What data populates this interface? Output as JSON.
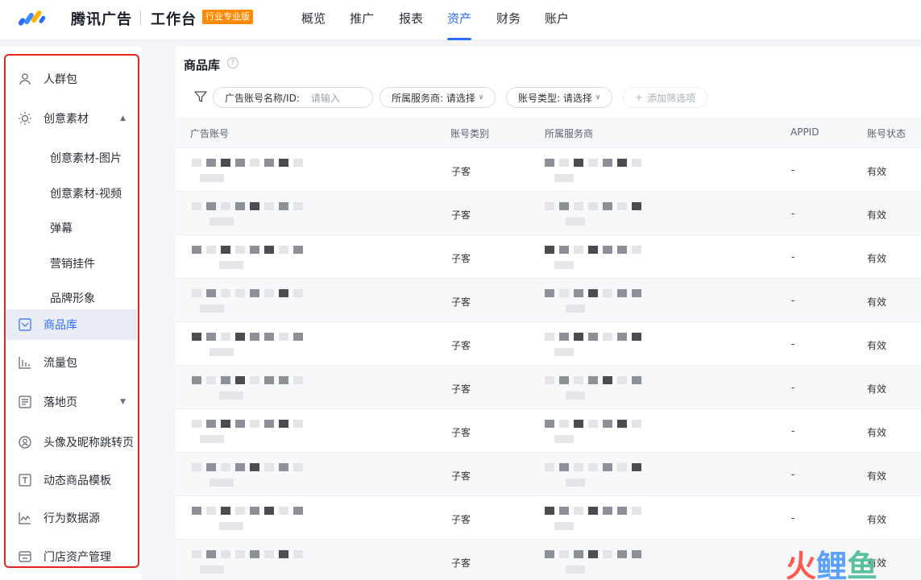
{
  "header": {
    "brand": "腾讯广告",
    "workspace": "工作台",
    "edition_badge": "行业专业版",
    "nav": [
      "概览",
      "推广",
      "报表",
      "资产",
      "财务",
      "账户"
    ],
    "nav_active": "资产",
    "accent": "#2f6bff",
    "badge_color": "#ff8a00"
  },
  "sidebar": {
    "items": [
      {
        "label": "人群包",
        "icon": "user-icon"
      },
      {
        "label": "创意素材",
        "icon": "lightbulb-icon"
      },
      {
        "label": "商品库",
        "icon": "product-icon"
      },
      {
        "label": "流量包",
        "icon": "bar-chart-icon"
      },
      {
        "label": "落地页",
        "icon": "landing-page-icon"
      },
      {
        "label": "头像及昵称跳转页",
        "icon": "avatar-link-icon"
      },
      {
        "label": "动态商品模板",
        "icon": "template-icon"
      },
      {
        "label": "行为数据源",
        "icon": "line-chart-icon"
      },
      {
        "label": "门店资产管理",
        "icon": "store-icon"
      }
    ],
    "subitems": [
      "创意素材-图片",
      "创意素材-视频",
      "弹幕",
      "营销挂件",
      "品牌形象"
    ],
    "active": "商品库",
    "outline_color": "#e8251f"
  },
  "main": {
    "title": "商品库",
    "filters": {
      "account_label": "广告账号名称/ID:",
      "account_placeholder": "请输入",
      "provider_label": "所属服务商: 请选择",
      "type_label": "账号类型: 请选择",
      "add_filter": "添加筛选项"
    },
    "table": {
      "headers": [
        "广告账号",
        "账号类别",
        "所属服务商",
        "APPID",
        "账号状态"
      ],
      "rows": [
        {
          "category": "子客",
          "appid": "-",
          "status": "有效"
        },
        {
          "category": "子客",
          "appid": "-",
          "status": "有效"
        },
        {
          "category": "子客",
          "appid": "-",
          "status": "有效"
        },
        {
          "category": "子客",
          "appid": "-",
          "status": "有效"
        },
        {
          "category": "子客",
          "appid": "-",
          "status": "有效"
        },
        {
          "category": "子客",
          "appid": "-",
          "status": "有效"
        },
        {
          "category": "子客",
          "appid": "-",
          "status": "有效"
        },
        {
          "category": "子客",
          "appid": "-",
          "status": "有效"
        },
        {
          "category": "子客",
          "appid": "-",
          "status": "有效"
        },
        {
          "category": "子客",
          "appid": "-",
          "status": "有效"
        }
      ]
    }
  },
  "watermark": {
    "chars": [
      "火",
      "鲤",
      "鱼"
    ]
  }
}
